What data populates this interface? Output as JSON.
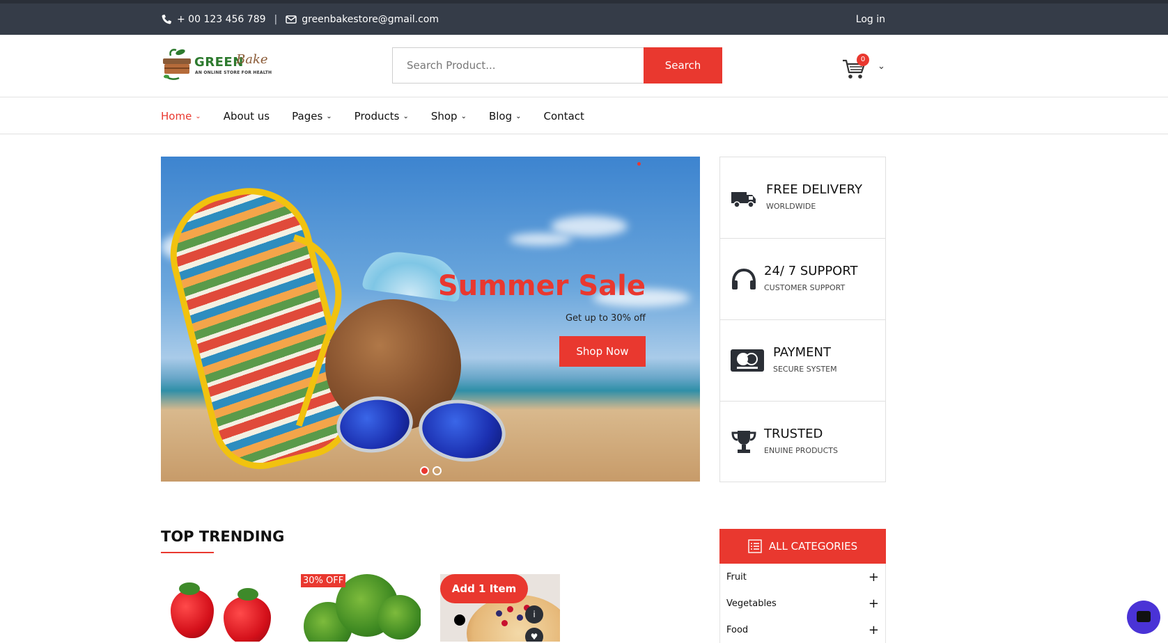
{
  "topbar": {
    "phone": "+ 00 123 456 789",
    "email": "greenbakestore@gmail.com",
    "login": "Log in"
  },
  "logo": {
    "name": "GREEN",
    "script": "Bake",
    "tagline": "AN ONLINE STORE FOR HEALTH"
  },
  "search": {
    "placeholder": "Search Product...",
    "button": "Search"
  },
  "cart": {
    "count": "0"
  },
  "nav": {
    "items": [
      {
        "label": "Home",
        "dropdown": true,
        "active": true
      },
      {
        "label": "About us",
        "dropdown": false
      },
      {
        "label": "Pages",
        "dropdown": true
      },
      {
        "label": "Products",
        "dropdown": true
      },
      {
        "label": "Shop",
        "dropdown": true
      },
      {
        "label": "Blog",
        "dropdown": true
      },
      {
        "label": "Contact",
        "dropdown": false
      }
    ]
  },
  "hero": {
    "title": "Summer Sale",
    "subtitle": "Get up to 30% off",
    "button": "Shop Now",
    "slides": 2,
    "active_slide": 1
  },
  "features": [
    {
      "title": "FREE DELIVERY",
      "subtitle": "WORLDWIDE",
      "icon": "truck-icon"
    },
    {
      "title": "24/ 7 SUPPORT",
      "subtitle": "CUSTOMER SUPPORT",
      "icon": "headphones-icon"
    },
    {
      "title": "PAYMENT",
      "subtitle": "SECURE SYSTEM",
      "icon": "mastercard-icon"
    },
    {
      "title": "TRUSTED",
      "subtitle": "ENUINE PRODUCTS",
      "icon": "trophy-icon"
    }
  ],
  "trending": {
    "heading": "TOP TRENDING",
    "products": [
      {
        "badge": "",
        "image": "strawberries"
      },
      {
        "badge": "30% OFF",
        "image": "broccoli"
      },
      {
        "badge": "",
        "image": "berry-tart",
        "add_button": "Add 1 Item"
      }
    ]
  },
  "categories": {
    "heading": "ALL CATEGORIES",
    "items": [
      "Fruit",
      "Vegetables",
      "Food"
    ]
  },
  "colors": {
    "accent": "#e9382f",
    "topbar": "#353c48",
    "chat": "#4a33d6"
  }
}
